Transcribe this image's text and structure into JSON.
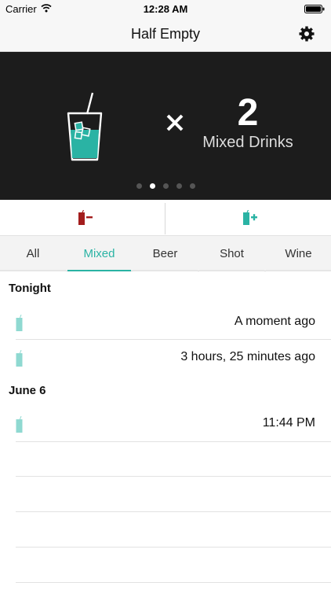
{
  "status_bar": {
    "carrier": "Carrier",
    "time": "12:28 AM"
  },
  "nav": {
    "title": "Half Empty",
    "settings_icon": "gear-icon"
  },
  "hero": {
    "count": "2",
    "label": "Mixed Drinks",
    "times_symbol": "×",
    "page_count": 5,
    "active_page": 2
  },
  "actions": {
    "remove_icon": "remove-drink-icon",
    "add_icon": "add-drink-icon",
    "remove_color": "#a31d1d",
    "add_color": "#2ab3a4"
  },
  "tabs": [
    {
      "label": "All"
    },
    {
      "label": "Mixed"
    },
    {
      "label": "Beer"
    },
    {
      "label": "Shot"
    },
    {
      "label": "Wine"
    }
  ],
  "active_tab": "Mixed",
  "sections": [
    {
      "title": "Tonight",
      "entries": [
        {
          "time": "A moment ago"
        },
        {
          "time": "3 hours, 25 minutes ago"
        }
      ]
    },
    {
      "title": "June 6",
      "entries": [
        {
          "time": "11:44 PM"
        }
      ]
    }
  ],
  "colors": {
    "accent": "#2ab3a4",
    "hero_background": "#1c1c1c",
    "remove": "#a31d1d"
  }
}
